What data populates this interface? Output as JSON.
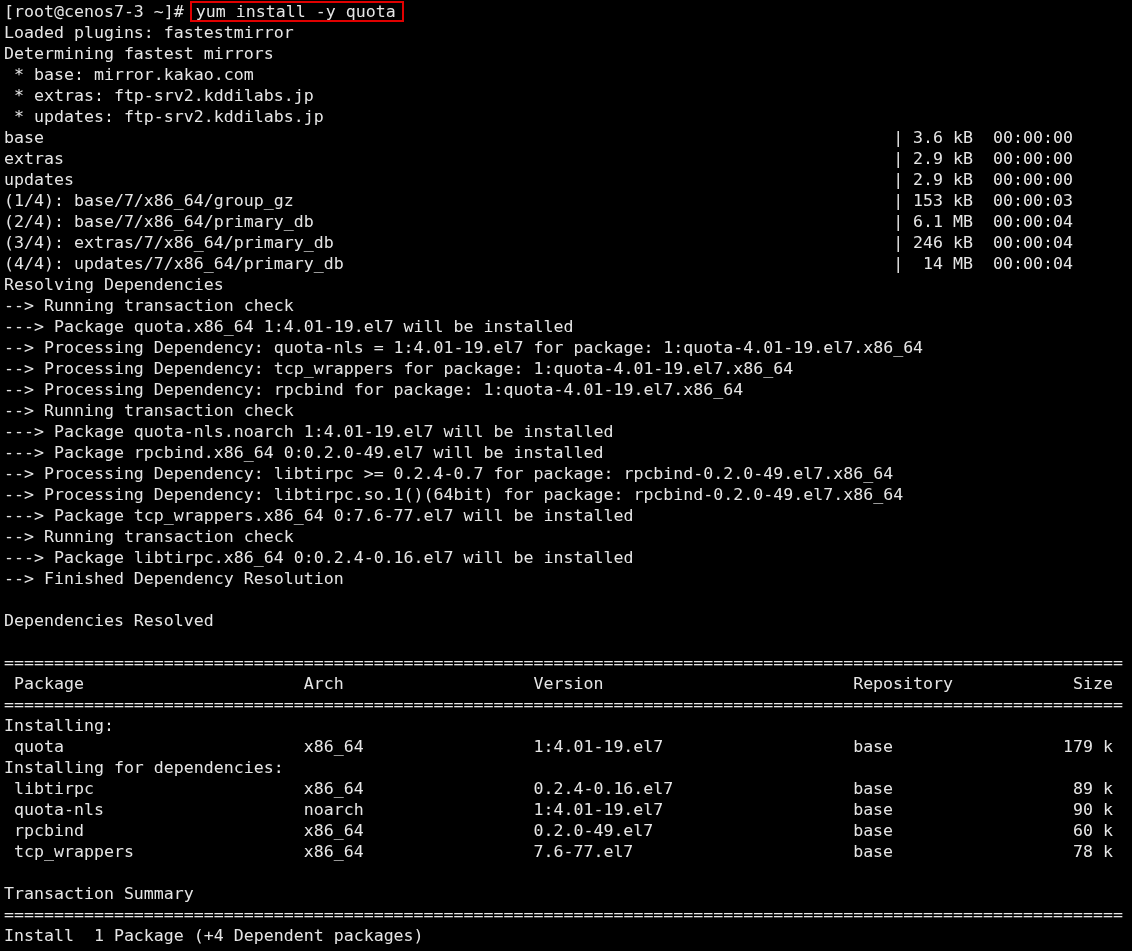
{
  "prompt": {
    "text": "[root@cenos7-3 ~]#",
    "command": "yum install -y quota"
  },
  "lines": [
    {
      "kind": "text",
      "text": "Loaded plugins: fastestmirror"
    },
    {
      "kind": "text",
      "text": "Determining fastest mirrors"
    },
    {
      "kind": "text",
      "text": " * base: mirror.kakao.com"
    },
    {
      "kind": "text",
      "text": " * extras: ftp-srv2.kddilabs.jp"
    },
    {
      "kind": "text",
      "text": " * updates: ftp-srv2.kddilabs.jp"
    },
    {
      "kind": "download",
      "name": "base",
      "bar": "|",
      "size": "3.6 kB",
      "time": "00:00:00"
    },
    {
      "kind": "download",
      "name": "extras",
      "bar": "|",
      "size": "2.9 kB",
      "time": "00:00:00"
    },
    {
      "kind": "download",
      "name": "updates",
      "bar": "|",
      "size": "2.9 kB",
      "time": "00:00:00"
    },
    {
      "kind": "download",
      "name": "(1/4): base/7/x86_64/group_gz",
      "bar": "|",
      "size": "153 kB",
      "time": "00:00:03"
    },
    {
      "kind": "download",
      "name": "(2/4): base/7/x86_64/primary_db",
      "bar": "|",
      "size": "6.1 MB",
      "time": "00:00:04"
    },
    {
      "kind": "download",
      "name": "(3/4): extras/7/x86_64/primary_db",
      "bar": "|",
      "size": "246 kB",
      "time": "00:00:04"
    },
    {
      "kind": "download",
      "name": "(4/4): updates/7/x86_64/primary_db",
      "bar": "|",
      "size": "14 MB",
      "time": "00:00:04"
    },
    {
      "kind": "text",
      "text": "Resolving Dependencies"
    },
    {
      "kind": "text",
      "text": "--> Running transaction check"
    },
    {
      "kind": "text",
      "text": "---> Package quota.x86_64 1:4.01-19.el7 will be installed"
    },
    {
      "kind": "text",
      "text": "--> Processing Dependency: quota-nls = 1:4.01-19.el7 for package: 1:quota-4.01-19.el7.x86_64"
    },
    {
      "kind": "text",
      "text": "--> Processing Dependency: tcp_wrappers for package: 1:quota-4.01-19.el7.x86_64"
    },
    {
      "kind": "text",
      "text": "--> Processing Dependency: rpcbind for package: 1:quota-4.01-19.el7.x86_64"
    },
    {
      "kind": "text",
      "text": "--> Running transaction check"
    },
    {
      "kind": "text",
      "text": "---> Package quota-nls.noarch 1:4.01-19.el7 will be installed"
    },
    {
      "kind": "text",
      "text": "---> Package rpcbind.x86_64 0:0.2.0-49.el7 will be installed"
    },
    {
      "kind": "text",
      "text": "--> Processing Dependency: libtirpc >= 0.2.4-0.7 for package: rpcbind-0.2.0-49.el7.x86_64"
    },
    {
      "kind": "text",
      "text": "--> Processing Dependency: libtirpc.so.1()(64bit) for package: rpcbind-0.2.0-49.el7.x86_64"
    },
    {
      "kind": "text",
      "text": "---> Package tcp_wrappers.x86_64 0:7.6-77.el7 will be installed"
    },
    {
      "kind": "text",
      "text": "--> Running transaction check"
    },
    {
      "kind": "text",
      "text": "---> Package libtirpc.x86_64 0:0.2.4-0.16.el7 will be installed"
    },
    {
      "kind": "text",
      "text": "--> Finished Dependency Resolution"
    },
    {
      "kind": "blank"
    },
    {
      "kind": "text",
      "text": "Dependencies Resolved"
    },
    {
      "kind": "blank"
    },
    {
      "kind": "rule",
      "text": "================================================================================================================"
    },
    {
      "kind": "row",
      "cells": [
        "Package",
        "Arch",
        "Version",
        "Repository",
        "Size"
      ]
    },
    {
      "kind": "rule",
      "text": "================================================================================================================"
    },
    {
      "kind": "text",
      "text": "Installing:"
    },
    {
      "kind": "row",
      "cells": [
        "quota",
        "x86_64",
        "1:4.01-19.el7",
        "base",
        "179 k"
      ]
    },
    {
      "kind": "text",
      "text": "Installing for dependencies:"
    },
    {
      "kind": "row",
      "cells": [
        "libtirpc",
        "x86_64",
        "0.2.4-0.16.el7",
        "base",
        "89 k"
      ]
    },
    {
      "kind": "row",
      "cells": [
        "quota-nls",
        "noarch",
        "1:4.01-19.el7",
        "base",
        "90 k"
      ]
    },
    {
      "kind": "row",
      "cells": [
        "rpcbind",
        "x86_64",
        "0.2.0-49.el7",
        "base",
        "60 k"
      ]
    },
    {
      "kind": "row",
      "cells": [
        "tcp_wrappers",
        "x86_64",
        "7.6-77.el7",
        "base",
        "78 k"
      ]
    },
    {
      "kind": "blank"
    },
    {
      "kind": "text",
      "text": "Transaction Summary"
    },
    {
      "kind": "rule",
      "text": "================================================================================================================"
    },
    {
      "kind": "text",
      "text": "Install  1 Package (+4 Dependent packages)"
    }
  ]
}
